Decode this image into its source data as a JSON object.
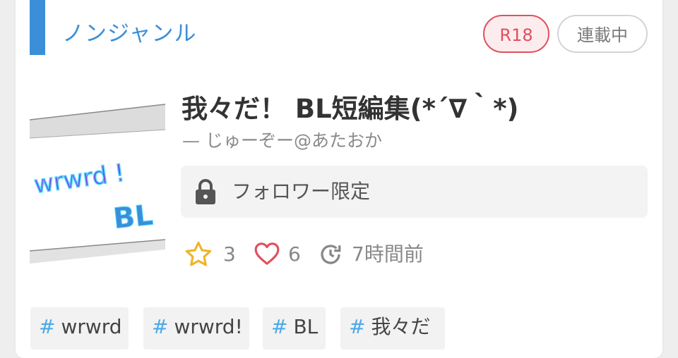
{
  "card": {
    "genre": "ノンジャンル",
    "badges": {
      "rating": "R18",
      "status": "連載中"
    },
    "thumbnail": {
      "text1": "wrwrd !",
      "text2": "BL"
    },
    "title": "我々だ！ BL短編集(*´∇｀*)",
    "author": "— じゅーぞー@あたおか",
    "locked_label": "フォロワー限定",
    "stats": {
      "stars": "3",
      "likes": "6",
      "updated": "7時間前"
    },
    "tags": [
      {
        "hash": "#",
        "label": "wrwrd"
      },
      {
        "hash": "#",
        "label": "wrwrd!"
      },
      {
        "hash": "#",
        "label": "BL"
      },
      {
        "hash": "#",
        "label": "我々だ"
      }
    ]
  },
  "colors": {
    "accent": "#3a8fd8",
    "r18": "#e0505e",
    "star": "#f0b429",
    "heart": "#e0505e",
    "tag_hash": "#4ba9e6"
  },
  "icons": [
    "lock-icon",
    "star-icon",
    "heart-icon",
    "clock-refresh-icon"
  ]
}
